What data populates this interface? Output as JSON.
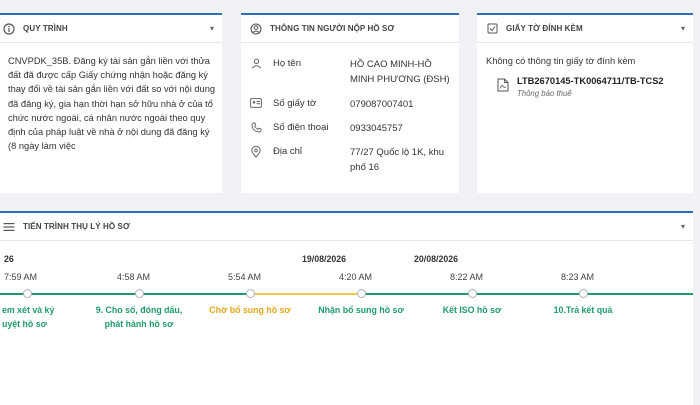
{
  "process_card": {
    "title": "QUY TRÌNH",
    "description": "CNVPDK_35B. Đăng ký tài sản gắn liền với thửa đất đã được cấp Giấy chứng nhận hoặc đăng ký thay đổi về tài sản gắn liền với đất so với nội dung đã đăng ký, gia hạn thời hạn sở hữu nhà ở của tổ chức nước ngoài, cá nhân nước ngoài theo quy định của pháp luật về nhà ở nội dung đã đăng ký (8 ngày làm việc"
  },
  "applicant_card": {
    "title": "THÔNG TIN NGƯỜI NỘP HỒ SƠ",
    "rows": [
      {
        "icon": "user-icon",
        "label": "Họ tên",
        "value": "HỒ CAO MINH-HỒ MINH PHƯƠNG (ĐSH)"
      },
      {
        "icon": "id-card-icon",
        "label": "Số giấy tờ",
        "value": "079087007401"
      },
      {
        "icon": "phone-icon",
        "label": "Số điện thoại",
        "value": "0933045757"
      },
      {
        "icon": "location-pin-icon",
        "label": "Địa chỉ",
        "value": "77/27 Quốc lộ 1K, khu phố 16"
      }
    ]
  },
  "attachments_card": {
    "title": "GIẤY TỜ ĐÍNH KÈM",
    "empty_text": "Không có thông tin giấy tờ đính kèm",
    "items": [
      {
        "icon": "pdf-file-icon",
        "name": "LTB2670145-TK0064711/TB-TCS2",
        "type": "Thông báo thuế"
      }
    ]
  },
  "progress_card": {
    "title": "TIẾN TRÌNH THỤ LÝ HỒ SƠ",
    "dates": [
      "26",
      "19/08/2026",
      "20/08/2026"
    ],
    "steps": [
      {
        "time": "7:59 AM",
        "label": "em xét và ký\nuyệt hồ sơ",
        "status": "done"
      },
      {
        "time": "4:58 AM",
        "label": "9. Cho số, đóng dấu,\nphát hành hồ sơ",
        "status": "done"
      },
      {
        "time": "5:54 AM",
        "label": "Chờ bổ sung hồ sơ",
        "status": "pending"
      },
      {
        "time": "4:20 AM",
        "label": "Nhận bổ sung hồ sơ",
        "status": "done"
      },
      {
        "time": "8:22 AM",
        "label": "Kết ISO hồ sơ",
        "status": "done"
      },
      {
        "time": "8:23 AM",
        "label": "10.Trả kết quả",
        "status": "done"
      }
    ],
    "colors": {
      "done": "#1f9b6a",
      "pending": "#e6a817"
    }
  }
}
